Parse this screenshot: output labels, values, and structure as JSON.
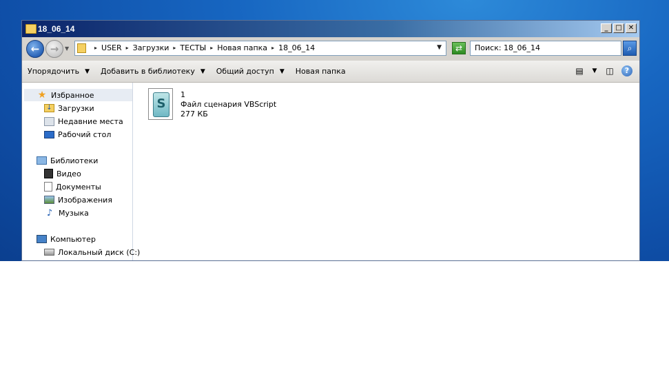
{
  "window": {
    "title": "18_06_14",
    "minimize_glyph": "_",
    "maximize_glyph": "□",
    "close_glyph": "✕"
  },
  "address": {
    "crumbs": [
      "USER",
      "Загрузки",
      "ТЕСТЫ",
      "Новая папка",
      "18_06_14"
    ],
    "search_placeholder": "Поиск: 18_06_14"
  },
  "toolbar": {
    "organize": "Упорядочить",
    "add_to_library": "Добавить в библиотеку",
    "share": "Общий доступ",
    "new_folder": "Новая папка"
  },
  "nav": {
    "favorites": "Избранное",
    "downloads": "Загрузки",
    "recent": "Недавние места",
    "desktop": "Рабочий стол",
    "libraries": "Библиотеки",
    "video": "Видео",
    "documents": "Документы",
    "images": "Изображения",
    "music": "Музыка",
    "computer": "Компьютер",
    "local_disk": "Локальный диск (C:)"
  },
  "files": [
    {
      "name": "1",
      "type": "Файл сценария VBScript",
      "size": "277 КБ"
    }
  ],
  "colors": {
    "desktop": "#1766c1",
    "titlebar": "#0a246a",
    "window_face": "#d6d3ce"
  },
  "icons": {
    "back": "back-arrow-icon",
    "forward": "forward-arrow-icon",
    "refresh": "refresh-icon",
    "search": "search-icon",
    "help": "help-icon"
  }
}
